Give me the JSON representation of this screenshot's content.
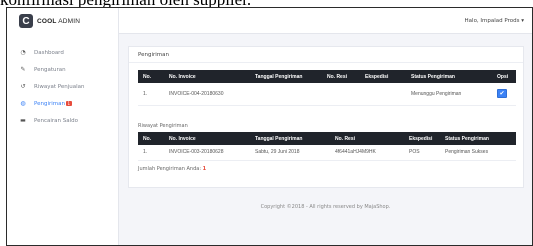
{
  "caption": "konfirmasi pengiriman oleh supplier.",
  "brand": {
    "logo_letter": "C",
    "name_bold": "COOL",
    "name_rest": "ADMIN"
  },
  "user": "Halo, Impalad Prods ▾",
  "sidebar": {
    "items": [
      {
        "label": "Dashboard",
        "icon": "speedometer-icon"
      },
      {
        "label": "Pengaturan",
        "icon": "wrench-icon"
      },
      {
        "label": "Riwayat Penjualan",
        "icon": "history-icon"
      },
      {
        "label": "Pengiriman",
        "icon": "globe-icon",
        "badge": "1",
        "active": true
      },
      {
        "label": "Pencairan Saldo",
        "icon": "money-icon"
      }
    ]
  },
  "main": {
    "title": "Pengiriman",
    "table1": {
      "headers": [
        "No.",
        "No. Invoice",
        "Tanggal Pengiriman",
        "No. Resi",
        "Ekspedisi",
        "Status Pengiriman",
        "Opsi"
      ],
      "rows": [
        [
          "1.",
          "INVOICE-004-20180630",
          "",
          "",
          "",
          "Menunggu Pengiriman",
          "✔"
        ]
      ]
    },
    "history_title": "Riwayat Pengiriman",
    "table2": {
      "headers": [
        "No.",
        "No. Invoice",
        "Tanggal Pengiriman",
        "No. Resi",
        "Ekspedisi",
        "Status Pengiriman"
      ],
      "rows": [
        [
          "1.",
          "INVOICE-003-20180628",
          "Sabtu, 29 Juni 2018",
          "4f6441aHJ4M9HK",
          "POS",
          "Pengiriman Sukses"
        ]
      ]
    },
    "count_label": "Jumlah Pengiriman Anda:",
    "count_value": "1"
  },
  "footer": "Copyright ©2018 - All rights reserved by MajaShop.",
  "colors": {
    "accent": "#3b82f6",
    "table_header": "#20242b",
    "badge": "#e74c3c"
  }
}
